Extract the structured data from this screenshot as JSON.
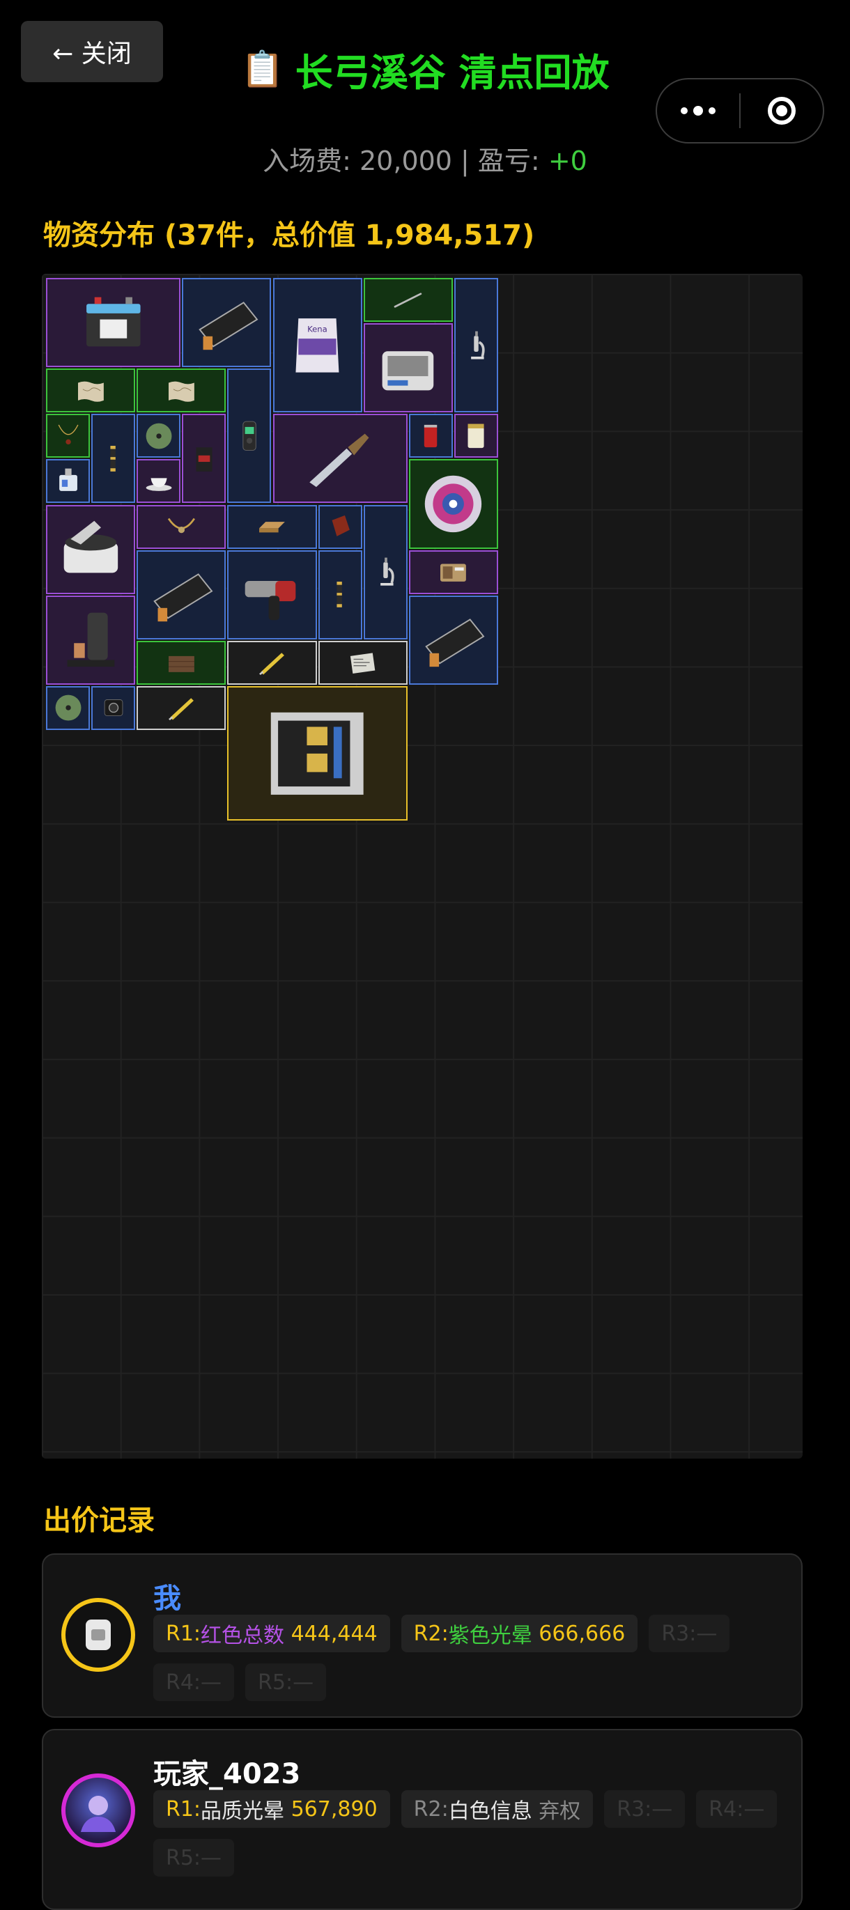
{
  "header": {
    "close_label": "← 关闭",
    "title_icon": "📋",
    "title": "长弓溪谷 清点回放",
    "more_icon": "more-dots-icon",
    "target_icon": "record-target-icon"
  },
  "fee": {
    "label": "入场费: 20,000 | 盈亏: ",
    "profit": "+0"
  },
  "inventory": {
    "heading": "物资分布 (37件，总价值 1,984,517)",
    "colors": {
      "purple": "#9b4fd6",
      "blue": "#4a78d8",
      "green": "#3cc43c",
      "gold": "#e8c12a",
      "white": "#cfcfcf"
    },
    "items": [
      {
        "icon": "car-battery-icon",
        "rarity": "purple"
      },
      {
        "icon": "display-panel-icon",
        "rarity": "blue"
      },
      {
        "icon": "cement-bag-icon",
        "rarity": "blue"
      },
      {
        "icon": "metal-rod-icon",
        "rarity": "green"
      },
      {
        "icon": "microscope-icon",
        "rarity": "blue"
      },
      {
        "icon": "incubator-shaker-icon",
        "rarity": "purple"
      },
      {
        "icon": "old-map-icon",
        "rarity": "green"
      },
      {
        "icon": "old-map-icon",
        "rarity": "green"
      },
      {
        "icon": "voice-recorder-icon",
        "rarity": "blue"
      },
      {
        "icon": "ornate-knife-icon",
        "rarity": "purple"
      },
      {
        "icon": "cola-can-icon",
        "rarity": "blue"
      },
      {
        "icon": "jar-icon",
        "rarity": "purple"
      },
      {
        "icon": "necklace-icon",
        "rarity": "green"
      },
      {
        "icon": "spyglass-icon",
        "rarity": "blue"
      },
      {
        "icon": "disc-icon",
        "rarity": "blue"
      },
      {
        "icon": "coffee-pouch-icon",
        "rarity": "purple"
      },
      {
        "icon": "id-badge-icon",
        "rarity": "blue"
      },
      {
        "icon": "teacup-icon",
        "rarity": "purple"
      },
      {
        "icon": "decorative-plate-icon",
        "rarity": "green"
      },
      {
        "icon": "centrifuge-icon",
        "rarity": "purple"
      },
      {
        "icon": "horn-necklace-icon",
        "rarity": "purple"
      },
      {
        "icon": "honeycomb-panel-icon",
        "rarity": "blue"
      },
      {
        "icon": "small-pouch-icon",
        "rarity": "blue"
      },
      {
        "icon": "microscope-icon",
        "rarity": "blue"
      },
      {
        "icon": "display-panel-icon",
        "rarity": "blue"
      },
      {
        "icon": "hammer-drill-icon",
        "rarity": "blue"
      },
      {
        "icon": "spyglass-icon",
        "rarity": "blue"
      },
      {
        "icon": "radio-icon",
        "rarity": "purple"
      },
      {
        "icon": "espresso-machine-icon",
        "rarity": "purple"
      },
      {
        "icon": "wood-planks-icon",
        "rarity": "green"
      },
      {
        "icon": "utility-knife-icon",
        "rarity": "white"
      },
      {
        "icon": "newspaper-icon",
        "rarity": "white"
      },
      {
        "icon": "display-panel-icon",
        "rarity": "blue"
      },
      {
        "icon": "disc-icon",
        "rarity": "blue"
      },
      {
        "icon": "action-camera-icon",
        "rarity": "blue"
      },
      {
        "icon": "utility-knife-icon",
        "rarity": "white"
      },
      {
        "icon": "server-board-icon",
        "rarity": "gold"
      }
    ]
  },
  "bids": {
    "heading": "出价记录",
    "records": [
      {
        "name": "我",
        "avatar_icon": "sim-card-icon",
        "r1_prefix": "R1:",
        "r1_label": "红色总数",
        "r1_value": "444,444",
        "r2_prefix": "R2:",
        "r2_label": "紫色光晕",
        "r2_value": "666,666",
        "r3": "R3:—",
        "r4": "R4:—",
        "r5": "R5:—"
      },
      {
        "name": "玩家_4023",
        "avatar_icon": "player-portrait-icon",
        "r1_prefix": "R1:",
        "r1_label": "品质光晕",
        "r1_value": "567,890",
        "r2_prefix": "R2:",
        "r2_label": "白色信息",
        "r2_value": "弃权",
        "r3": "R3:—",
        "r4": "R4:—",
        "r5": "R5:—"
      }
    ]
  }
}
